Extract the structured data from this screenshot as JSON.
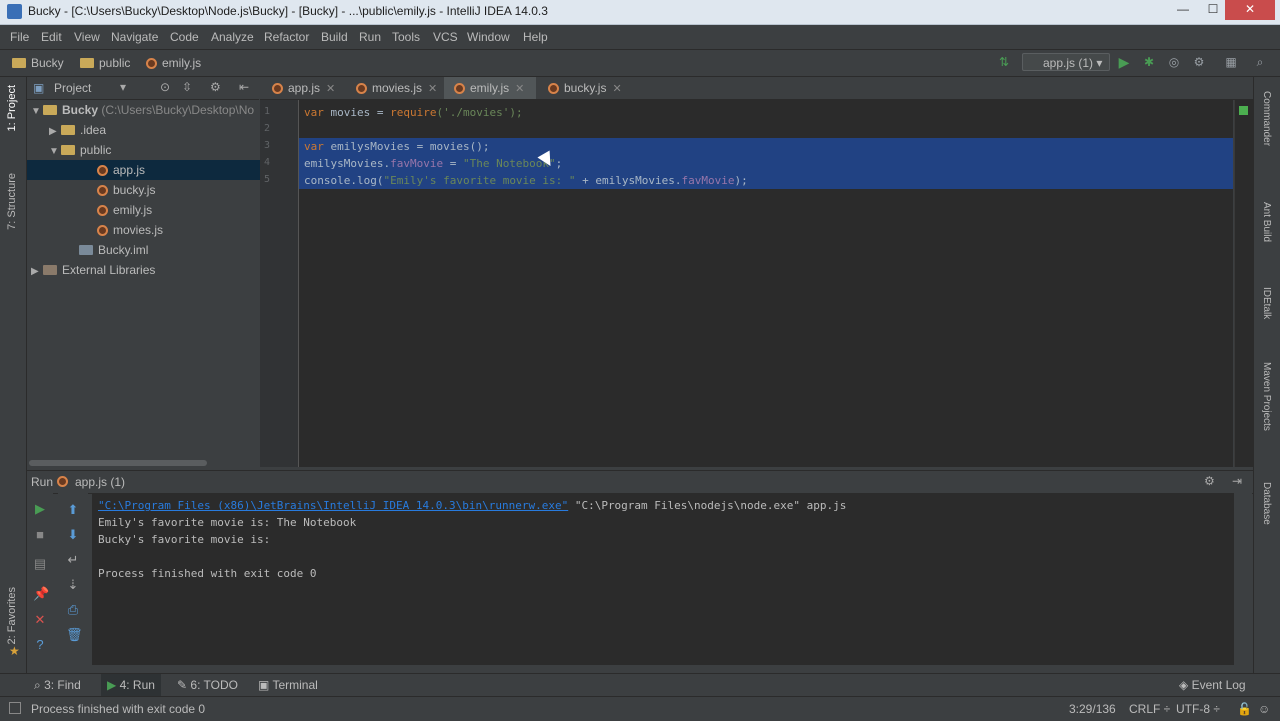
{
  "window": {
    "title": "Bucky - [C:\\Users\\Bucky\\Desktop\\Node.js\\Bucky] - [Bucky] - ...\\public\\emily.js - IntelliJ IDEA 14.0.3",
    "minimize": "—",
    "maximize": "☐",
    "close": "✕"
  },
  "menu": [
    "File",
    "Edit",
    "View",
    "Navigate",
    "Code",
    "Analyze",
    "Refactor",
    "Build",
    "Run",
    "Tools",
    "VCS",
    "Window",
    "Help"
  ],
  "breadcrumb": [
    "Bucky",
    "public",
    "emily.js"
  ],
  "run_config": "app.js (1)",
  "left_stripe": {
    "project": "1: Project",
    "structure": "7: Structure",
    "favorites": "2: Favorites"
  },
  "right_stripe": [
    "Commander",
    "Ant Build",
    "IDEtalk",
    "Maven Projects",
    "Database"
  ],
  "project_panel": {
    "title": "Project",
    "tree": [
      {
        "label": "Bucky",
        "extra": " (C:\\Users\\Bucky\\Desktop\\No",
        "icon": "folder",
        "arrow": "▼",
        "indent": 0
      },
      {
        "label": ".idea",
        "icon": "folder",
        "arrow": "▶",
        "indent": 1
      },
      {
        "label": "public",
        "icon": "folder",
        "arrow": "▼",
        "indent": 1
      },
      {
        "label": "app.js",
        "icon": "js",
        "arrow": "",
        "indent": 3,
        "selected": true
      },
      {
        "label": "bucky.js",
        "icon": "js",
        "arrow": "",
        "indent": 3
      },
      {
        "label": "emily.js",
        "icon": "js",
        "arrow": "",
        "indent": 3
      },
      {
        "label": "movies.js",
        "icon": "js",
        "arrow": "",
        "indent": 3
      },
      {
        "label": "Bucky.iml",
        "icon": "iml",
        "arrow": "",
        "indent": 2
      },
      {
        "label": "External Libraries",
        "icon": "lib",
        "arrow": "▶",
        "indent": 0
      }
    ]
  },
  "editor_tabs": [
    {
      "label": "app.js"
    },
    {
      "label": "movies.js"
    },
    {
      "label": "emily.js",
      "active": true
    },
    {
      "label": "bucky.js"
    }
  ],
  "code_lines": [
    "1",
    "2",
    "3",
    "4",
    "5"
  ],
  "code": {
    "l1a": "var",
    "l1b": " movies = ",
    "l1c": "require",
    "l1d": "('./movies');",
    "l3a": "var",
    "l3b": " emilysMovies = movies();",
    "l4a": "emilysMovies.",
    "l4b": "favMovie",
    "l4c": " = ",
    "l4d": "\"The Notebook\"",
    "l4e": ";",
    "l5a": "console.log(",
    "l5b": "\"Emily's favorite movie is: \"",
    "l5c": " + emilysMovies.",
    "l5d": "favMovie",
    "l5e": ");"
  },
  "run_panel": {
    "label": "Run",
    "config": "app.js (1)",
    "console": {
      "cmd_link": "\"C:\\Program Files (x86)\\JetBrains\\IntelliJ IDEA 14.0.3\\bin\\runnerw.exe\"",
      "cmd_rest": " \"C:\\Program Files\\nodejs\\node.exe\" app.js",
      "out1": "Emily's favorite movie is: The Notebook",
      "out2": "Bucky's favorite movie is:",
      "out3": "Process finished with exit code 0"
    }
  },
  "tool_windows": [
    "3: Find",
    "4: Run",
    "6: TODO",
    "Terminal"
  ],
  "event_log": "Event Log",
  "status": {
    "message": "Process finished with exit code 0",
    "position": "3:29/136",
    "line_sep": "CRLF ÷",
    "encoding": "UTF-8 ÷"
  },
  "colors": {
    "selection": "#214283",
    "keyword": "#cc7832",
    "string": "#6a8759",
    "property": "#9876aa",
    "run_green": "#499c54"
  }
}
